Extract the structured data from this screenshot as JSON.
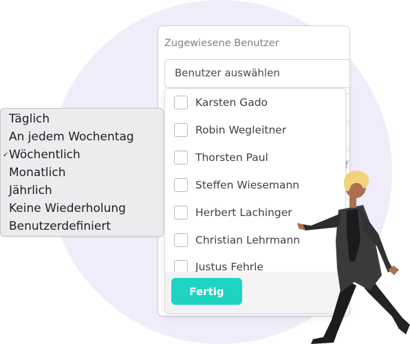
{
  "assign": {
    "label": "Zugewiesene Benutzer",
    "select_placeholder": "Benutzer auswählen",
    "bg_fragment": "f"
  },
  "users": [
    "Karsten Gado",
    "Robin Wegleitner",
    "Thorsten Paul",
    "Steffen Wiesemann",
    "Herbert Lachinger",
    "Christian Lehrmann",
    "Justus Fehrle"
  ],
  "done_label": "Fertig",
  "repeat_options": [
    "Täglich",
    "An jedem Wochentag",
    "Wöchentlich",
    "Monatlich",
    "Jährlich",
    "Keine Wiederholung",
    "Benutzerdefiniert"
  ],
  "repeat_selected": "Wöchentlich",
  "check_mark": "✓",
  "colors": {
    "accent": "#1fd3c3",
    "background_circle": "#f0ecf9",
    "menu_background": "#ececee"
  }
}
